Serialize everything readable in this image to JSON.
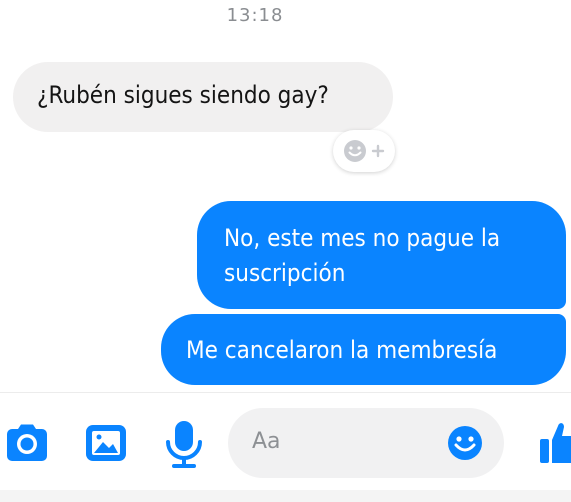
{
  "header": {
    "time": "13:18"
  },
  "messages": [
    {
      "direction": "incoming",
      "text": "¿Rubén sigues siendo gay?"
    },
    {
      "direction": "outgoing",
      "text": "No, este mes no pague la suscripción"
    },
    {
      "direction": "outgoing",
      "text": "Me cancelaron la membresía"
    }
  ],
  "reaction": {
    "icon": "add-reaction-icon"
  },
  "composer": {
    "placeholder": "Aa",
    "icons": [
      "camera-icon",
      "image-icon",
      "microphone-icon",
      "emoji-icon",
      "like-icon"
    ]
  },
  "colors": {
    "accent": "#0a84ff",
    "incoming_bubble": "#f1f0f0",
    "outgoing_text": "#ffffff",
    "timestamp": "#8a8d91"
  }
}
